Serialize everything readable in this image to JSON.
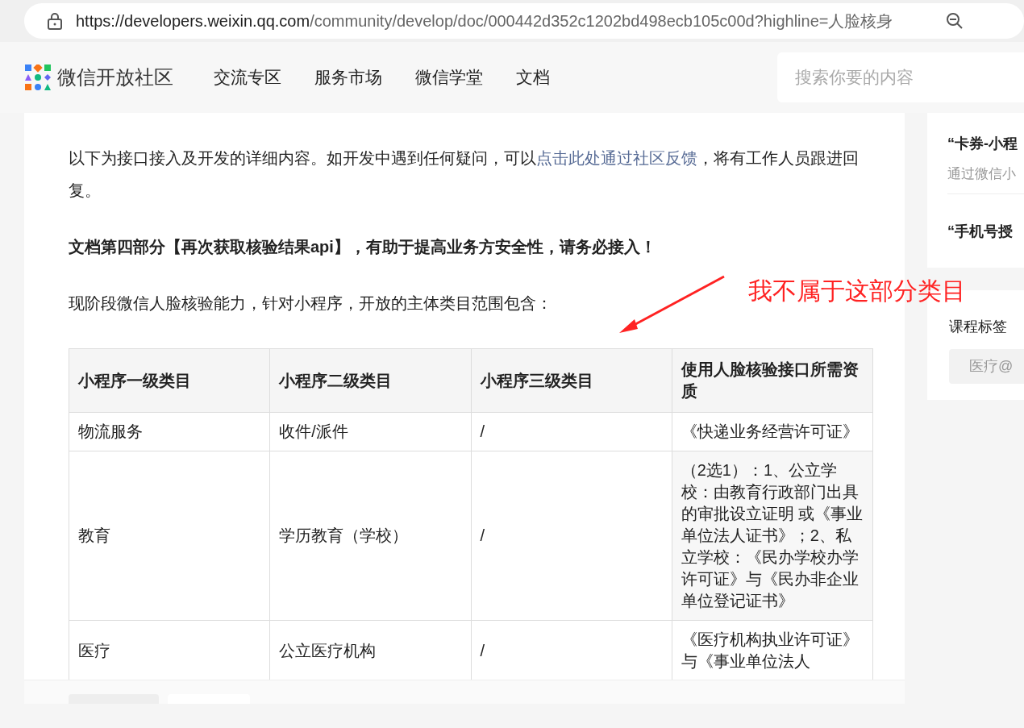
{
  "browser": {
    "url_host": "https://developers.weixin.qq.com",
    "url_path": "/community/develop/doc/000442d352c1202bd498ecb105c00d?highline=人脸核身"
  },
  "header": {
    "site_name": "微信开放社区",
    "nav": [
      {
        "label": "交流专区",
        "selected": false
      },
      {
        "label": "服务市场",
        "selected": false
      },
      {
        "label": "微信学堂",
        "selected": false
      },
      {
        "label": "文档",
        "selected": false
      }
    ],
    "search": {
      "placeholder": "搜索你要的内容"
    }
  },
  "article": {
    "intro": "以下为接口接入及开发的详细内容。如开发中遇到任何疑问，可以",
    "intro_link": "点击此处通过社区反馈",
    "intro_tail": "，将有工作人员跟进回复。",
    "notice": "文档第四部分【再次获取核验结果api】，有助于提高业务方安全性，请务必接入！",
    "scope": "现阶段微信人脸核验能力，针对小程序，开放的主体类目范围包含：",
    "table": {
      "columns": [
        "小程序一级类目",
        "小程序二级类目",
        "小程序三级类目",
        "使用人脸核验接口所需资质"
      ],
      "rows": [
        [
          "物流服务",
          "收件/派件",
          "/",
          "《快递业务经营许可证》"
        ],
        [
          "教育",
          "学历教育（学校）",
          "/",
          "（2选1）：1、公立学校：由教育行政部门出具的审批设立证明 或《事业单位法人证书》；2、私立学校：《民办学校办学许可证》与《民办非企业单位登记证书》"
        ],
        [
          "医疗",
          "公立医疗机构",
          "/",
          "《医疗机构执业许可证》与《事业单位法人"
        ]
      ]
    }
  },
  "annotation": {
    "text": "我不属于这部分类目"
  },
  "sidebar": {
    "articles": [
      {
        "title": "“卡券-小程",
        "summary": "通过微信小"
      },
      {
        "title": "“手机号授"
      }
    ],
    "tags_title": "课程标签",
    "tags": [
      "医疗@"
    ]
  }
}
